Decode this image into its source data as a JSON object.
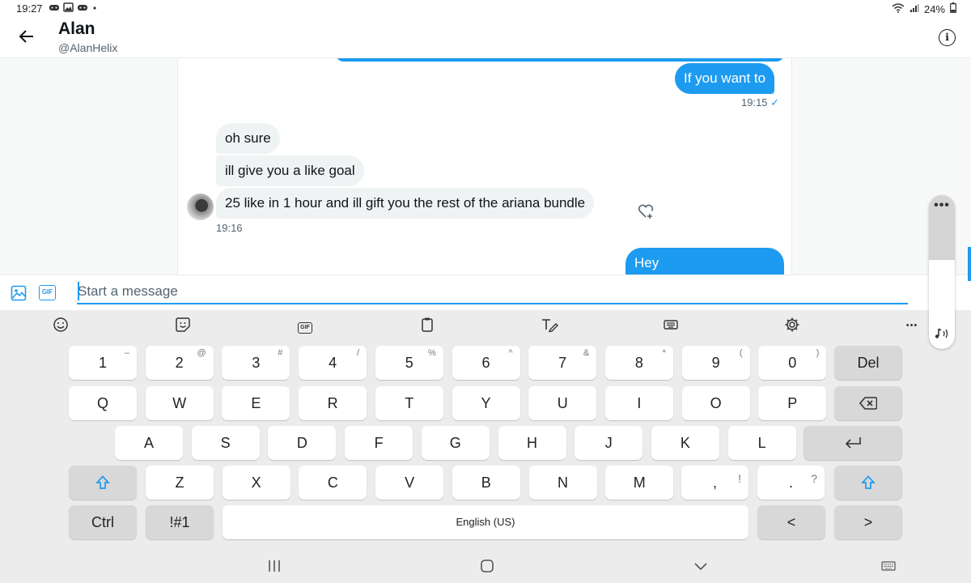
{
  "status_bar": {
    "time": "19:27",
    "battery": "24%"
  },
  "header": {
    "name": "Alan",
    "handle": "@AlanHelix"
  },
  "messages": {
    "out_1": {
      "text": "If you want to",
      "time": "19:15",
      "read_mark": "✓"
    },
    "in_1": {
      "text": "oh sure"
    },
    "in_2": {
      "text": "ill give you a like goal"
    },
    "in_3": {
      "text": "25 like in 1 hour and ill gift you the rest of the ariana bundle"
    },
    "in_time": "19:16",
    "out_2": {
      "text": "Hey"
    }
  },
  "composer": {
    "placeholder": "Start a message",
    "gif_label": "GIF"
  },
  "keyboard": {
    "toolbar_gif": "GIF",
    "toolbar_more": "•••",
    "row_numbers": [
      {
        "main": "1",
        "sub": "–"
      },
      {
        "main": "2",
        "sub": "@"
      },
      {
        "main": "3",
        "sub": "#"
      },
      {
        "main": "4",
        "sub": "/"
      },
      {
        "main": "5",
        "sub": "%"
      },
      {
        "main": "6",
        "sub": "^"
      },
      {
        "main": "7",
        "sub": "&"
      },
      {
        "main": "8",
        "sub": "*"
      },
      {
        "main": "9",
        "sub": "("
      },
      {
        "main": "0",
        "sub": ")"
      }
    ],
    "del": "Del",
    "row_q": [
      "Q",
      "W",
      "E",
      "R",
      "T",
      "Y",
      "U",
      "I",
      "O",
      "P"
    ],
    "row_a": [
      "A",
      "S",
      "D",
      "F",
      "G",
      "H",
      "J",
      "K",
      "L"
    ],
    "row_z": [
      "Z",
      "X",
      "C",
      "V",
      "B",
      "N",
      "M"
    ],
    "comma": {
      "main": ",",
      "sub": "!"
    },
    "period": {
      "main": ".",
      "sub": "?"
    },
    "ctrl": "Ctrl",
    "symbols": "!#1",
    "space": "English (US)",
    "left": "<",
    "right": ">"
  },
  "side_handle": {
    "dots": "•••"
  },
  "icons": {
    "back": "arrow-left-icon",
    "info": "info-circle-icon",
    "image": "image-icon",
    "gif": "gif-icon",
    "react": "heart-plus-icon",
    "emoji": "smiley-icon",
    "sticker": "sticker-icon",
    "clipboard": "clipboard-icon",
    "handwriting": "handwriting-icon",
    "keyboard": "keyboard-icon",
    "settings": "gear-icon"
  },
  "colors": {
    "accent": "#1d9bf0",
    "bubble_in": "#eff3f4",
    "keyboard_bg": "#ececec"
  }
}
